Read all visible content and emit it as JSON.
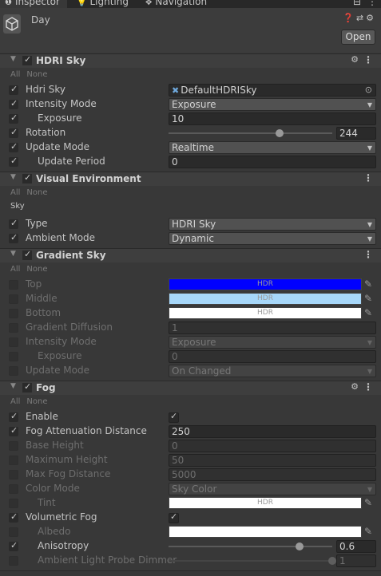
{
  "tabs": [
    {
      "label": "Inspector",
      "icon": "info-icon"
    },
    {
      "label": "Lighting",
      "icon": "bulb-icon"
    },
    {
      "label": "Navigation",
      "icon": "navigation-icon"
    }
  ],
  "object": {
    "name": "Day",
    "open_label": "Open"
  },
  "all_label": "All",
  "none_label": "None",
  "hdr_label": "HDR",
  "hdri_sky": {
    "title": "HDRI Sky",
    "hdri_sky": {
      "label": "Hdri Sky",
      "value": "DefaultHDRISky"
    },
    "intensity_mode": {
      "label": "Intensity Mode",
      "value": "Exposure"
    },
    "exposure": {
      "label": "Exposure",
      "value": "10"
    },
    "rotation": {
      "label": "Rotation",
      "value": "244",
      "fraction": 0.678
    },
    "update_mode": {
      "label": "Update Mode",
      "value": "Realtime"
    },
    "update_period": {
      "label": "Update Period",
      "value": "0"
    }
  },
  "visual_env": {
    "title": "Visual Environment",
    "section": "Sky",
    "type": {
      "label": "Type",
      "value": "HDRI Sky"
    },
    "ambient_mode": {
      "label": "Ambient Mode",
      "value": "Dynamic"
    }
  },
  "gradient_sky": {
    "title": "Gradient Sky",
    "top": {
      "label": "Top",
      "color": "#0000ff"
    },
    "middle": {
      "label": "Middle",
      "color": "#a7d7f9"
    },
    "bottom": {
      "label": "Bottom",
      "color": "#ffffff"
    },
    "gradient_diffusion": {
      "label": "Gradient Diffusion",
      "value": "1"
    },
    "intensity_mode": {
      "label": "Intensity Mode",
      "value": "Exposure"
    },
    "exposure": {
      "label": "Exposure",
      "value": "0"
    },
    "update_mode": {
      "label": "Update Mode",
      "value": "On Changed"
    }
  },
  "fog": {
    "title": "Fog",
    "enable": {
      "label": "Enable"
    },
    "attenuation": {
      "label": "Fog Attenuation Distance",
      "value": "250"
    },
    "base_height": {
      "label": "Base Height",
      "value": "0"
    },
    "max_height": {
      "label": "Maximum Height",
      "value": "50"
    },
    "max_fog_distance": {
      "label": "Max Fog Distance",
      "value": "5000"
    },
    "color_mode": {
      "label": "Color Mode",
      "value": "Sky Color"
    },
    "tint": {
      "label": "Tint",
      "color": "#ffffff"
    },
    "volumetric": {
      "label": "Volumetric Fog"
    },
    "albedo": {
      "label": "Albedo",
      "color": "#ffffff"
    },
    "anisotropy": {
      "label": "Anisotropy",
      "value": "0.6",
      "fraction": 0.8
    },
    "ambient_dimmer": {
      "label": "Ambient Light Probe Dimmer",
      "value": "1",
      "fraction": 1.0
    }
  }
}
